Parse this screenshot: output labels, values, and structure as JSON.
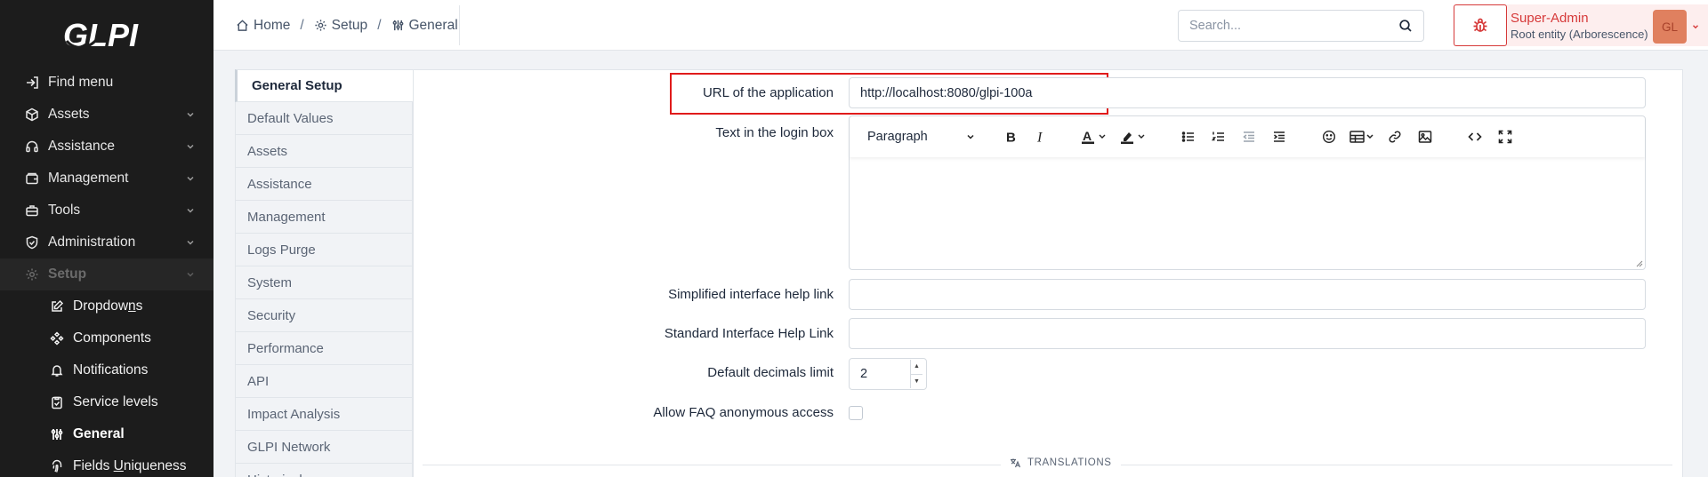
{
  "app": {
    "logo_text": "GLPI"
  },
  "sidebar": {
    "find_menu": "Find menu",
    "items": [
      {
        "label": "Assets",
        "icon": "cube-icon"
      },
      {
        "label": "Assistance",
        "icon": "headset-icon"
      },
      {
        "label": "Management",
        "icon": "wallet-icon"
      },
      {
        "label": "Tools",
        "icon": "briefcase-icon"
      },
      {
        "label": "Administration",
        "icon": "shield-check-icon"
      },
      {
        "label": "Setup",
        "icon": "gear-icon"
      }
    ],
    "setup_children": [
      {
        "label_pre": "Dropdow",
        "label_u": "n",
        "label_post": "s",
        "icon": "edit-icon"
      },
      {
        "label": "Components",
        "icon": "components-icon"
      },
      {
        "label": "Notifications",
        "icon": "bell-icon"
      },
      {
        "label": "Service levels",
        "icon": "clipboard-check-icon"
      },
      {
        "label": "General",
        "icon": "adjustments-icon"
      },
      {
        "label_pre": "Fields ",
        "label_u": "U",
        "label_post": "niqueness",
        "icon": "fingerprint-icon"
      }
    ]
  },
  "header": {
    "breadcrumb": [
      "Home",
      "Setup",
      "General"
    ],
    "search_placeholder": "Search...",
    "user_name": "Super-Admin",
    "user_entity": "Root entity (Arborescence)",
    "avatar_initials": "GL",
    "colors": {
      "danger": "#d63939",
      "avatar": "#e0805f"
    }
  },
  "tabs": [
    "General Setup",
    "Default Values",
    "Assets",
    "Assistance",
    "Management",
    "Logs Purge",
    "System",
    "Security",
    "Performance",
    "API",
    "Impact Analysis",
    "GLPI Network",
    "Historical"
  ],
  "form": {
    "url_label": "URL of the application",
    "url_value": "http://localhost:8080/glpi-100a",
    "login_text_label": "Text in the login box",
    "editor": {
      "paragraph_select": "Paragraph",
      "tools": [
        "bold-icon",
        "italic-icon",
        "text-color-icon",
        "highlight-icon",
        "bullet-list-icon",
        "numbered-list-icon",
        "outdent-icon",
        "indent-icon",
        "emoji-icon",
        "table-icon",
        "link-icon",
        "image-icon",
        "code-icon",
        "fullscreen-icon"
      ]
    },
    "simplified_help_label": "Simplified interface help link",
    "simplified_help_value": "",
    "standard_help_label": "Standard Interface Help Link",
    "standard_help_value": "",
    "decimals_label": "Default decimals limit",
    "decimals_value": "2",
    "faq_label": "Allow FAQ anonymous access",
    "faq_checked": false,
    "translations_title": "TRANSLATIONS"
  }
}
